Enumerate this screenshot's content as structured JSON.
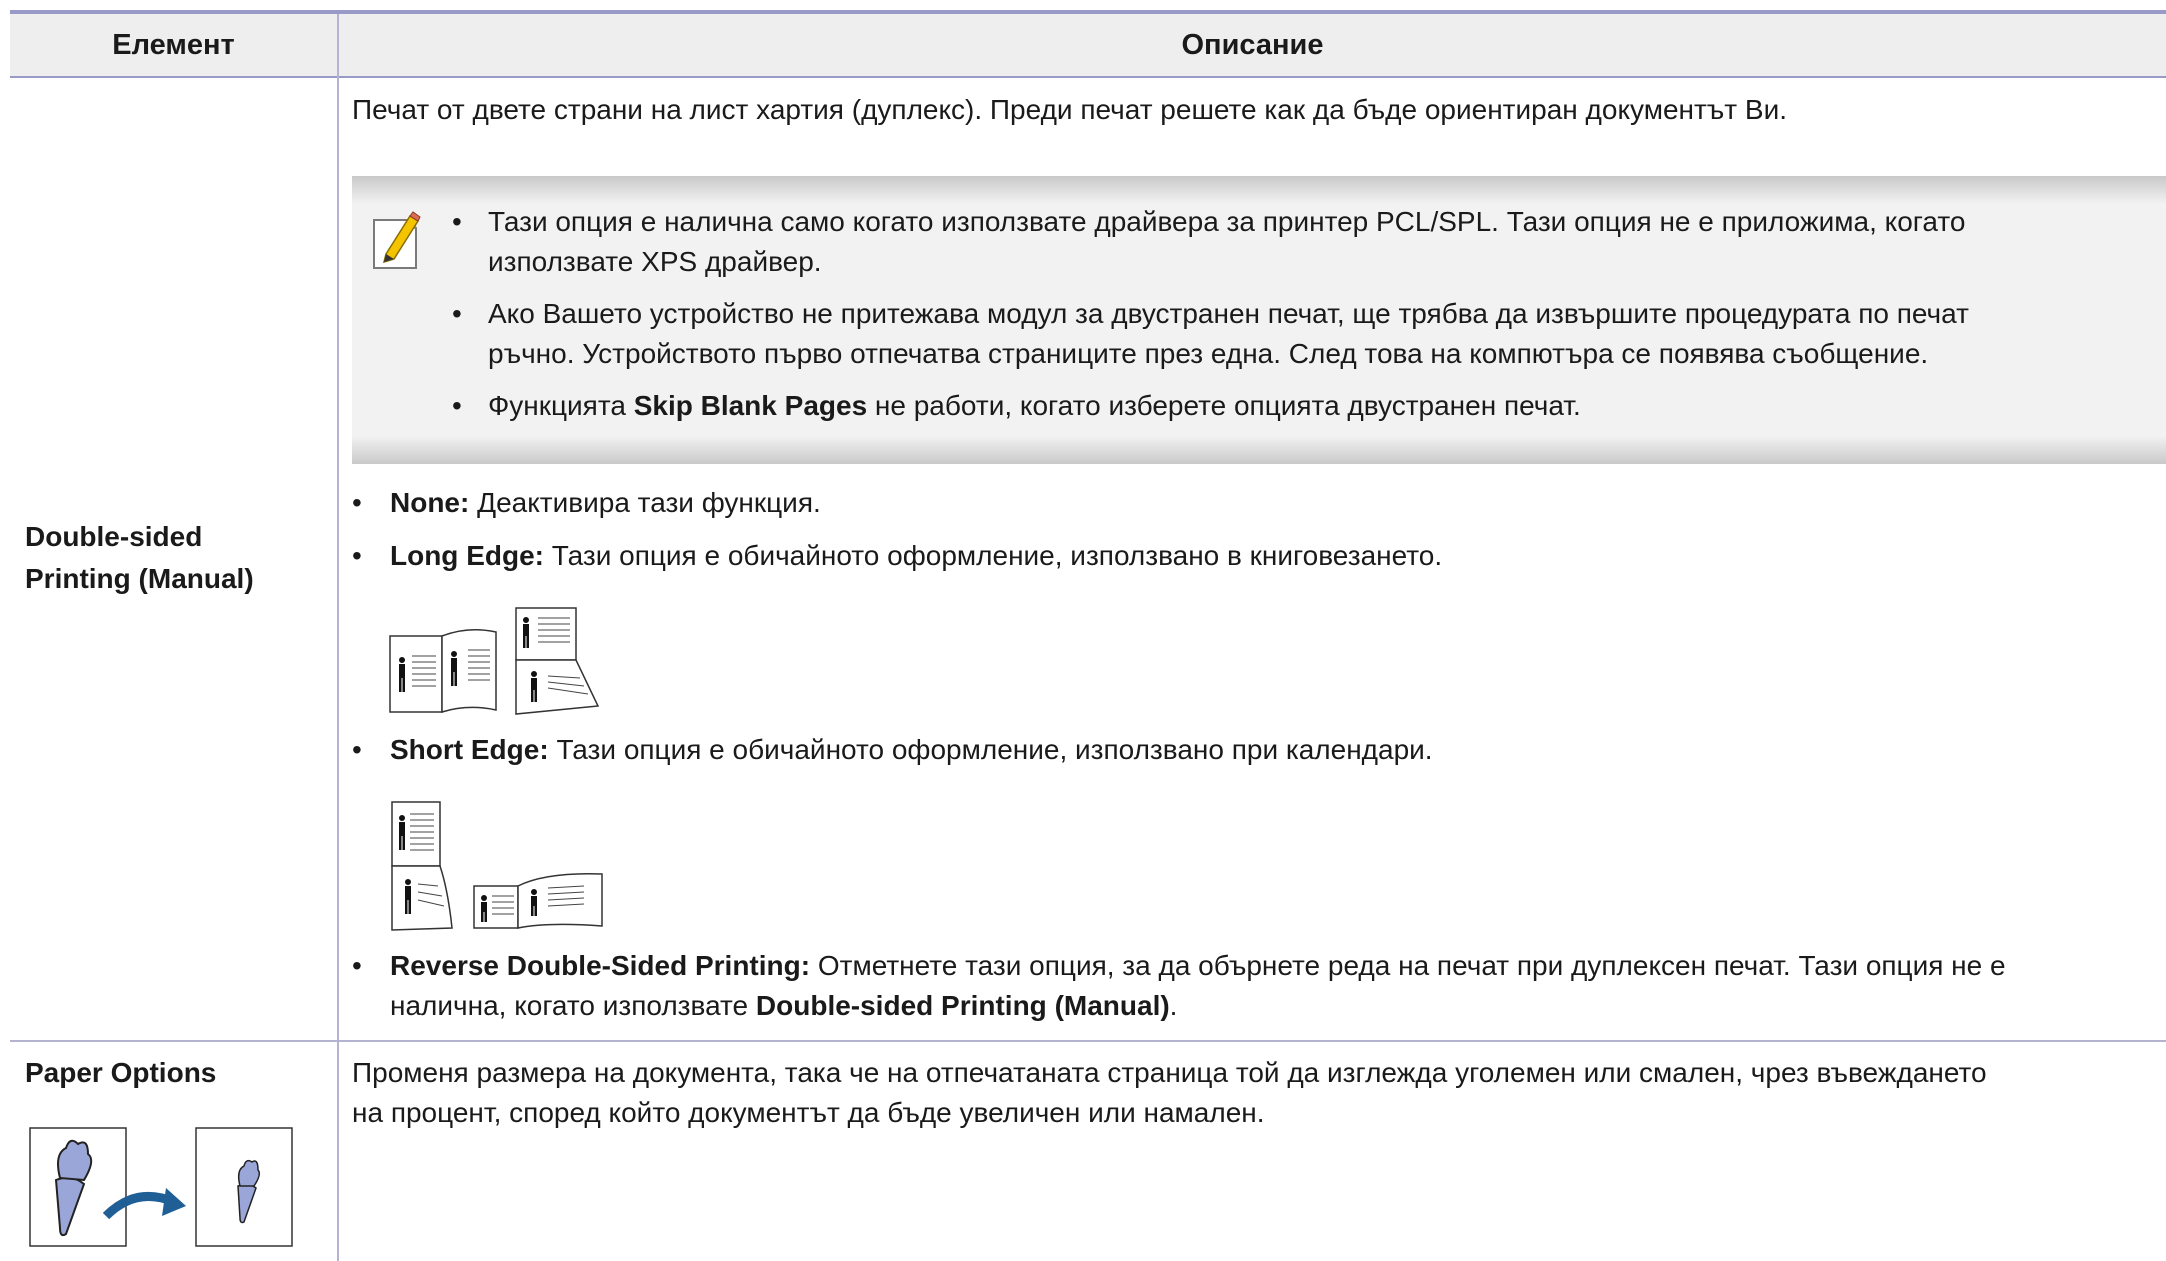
{
  "table": {
    "header": {
      "col_element": "Елемент",
      "col_description": "Описание"
    },
    "row1": {
      "label_line1": "Double-sided",
      "label_line2": "Printing (Manual)",
      "intro": "Печат от двете страни на лист хартия (дуплекс). Преди печат решете как да бъде ориентиран документът Ви.",
      "note": {
        "icon": "note-pencil-icon",
        "item1_line1": "Тази опция е налична само когато използвате драйвера за принтер PCL/SPL. Тази опция не е приложима, когато",
        "item1_line2": "използвате XPS драйвер.",
        "item2_line1": "Ако Вашето устройство не притежава модул за двустранен печат, ще трябва да извършите процедурата по печат",
        "item2_line2": "ръчно. Устройството първо отпечатва страниците през една. След това на компютъра се появява съобщение.",
        "item3_pre": "Функцията ",
        "item3_bold": "Skip Blank Pages",
        "item3_post": " не работи, когато изберете опцията двустранен печат."
      },
      "opt_none_label": "None:",
      "opt_none_text": " Деактивира тази функция.",
      "opt_long_label": "Long Edge:",
      "opt_long_text": " Тази опция е обичайното оформление, използвано в книговезането.",
      "opt_short_label": "Short Edge:",
      "opt_short_text": " Тази опция е обичайното оформление, използвано при календари.",
      "opt_reverse_label": "Reverse Double-Sided Printing:",
      "opt_reverse_text1": " Отметнете тази опция, за да обърнете реда на печат при дуплексен печат. Тази опция не е",
      "opt_reverse_text2_pre": "налична, когато използвате ",
      "opt_reverse_text2_bold": "Double-sided Printing (Manual)",
      "opt_reverse_text2_post": "."
    },
    "row2": {
      "label": "Paper Options",
      "text_line1": "Променя размера на документа, така че на отпечатаната страница той да изглежда уголемен или смален, чрез въвеждането",
      "text_line2": "на процент, според който документът да бъде увеличен или намален."
    }
  },
  "colors": {
    "rule": "#9a9ac8",
    "header_bg": "#eeeeef",
    "note_bg": "#f2f2f2",
    "arrow": "#1f5f96"
  }
}
